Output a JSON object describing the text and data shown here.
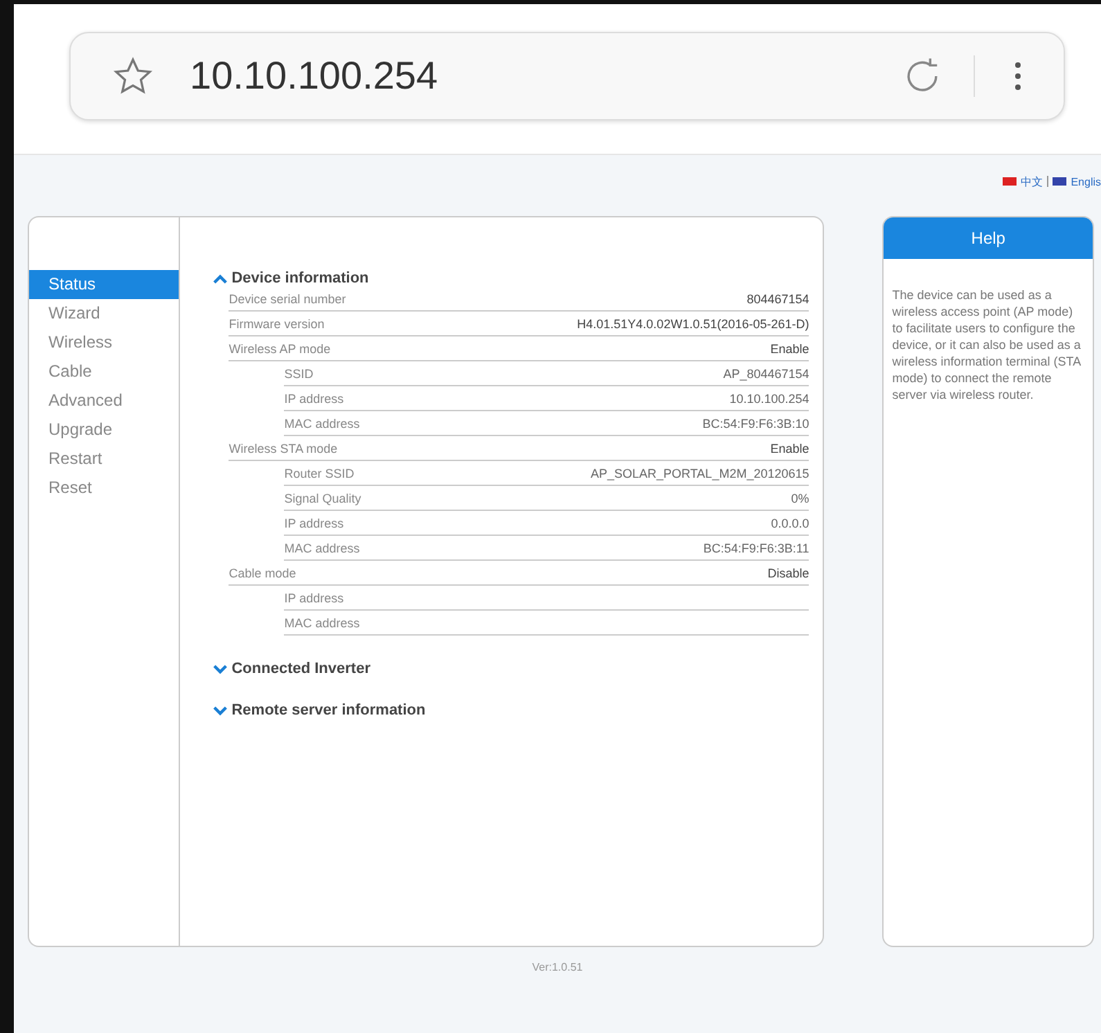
{
  "browser": {
    "url": "10.10.100.254"
  },
  "language": {
    "items": [
      {
        "label": "中文",
        "color": "#dd2222"
      },
      {
        "label": "Englis",
        "color": "#3344aa"
      }
    ]
  },
  "sidebar": {
    "items": [
      {
        "label": "Status",
        "selected": true
      },
      {
        "label": "Wizard",
        "selected": false
      },
      {
        "label": "Wireless",
        "selected": false
      },
      {
        "label": "Cable",
        "selected": false
      },
      {
        "label": "Advanced",
        "selected": false
      },
      {
        "label": "Upgrade",
        "selected": false
      },
      {
        "label": "Restart",
        "selected": false
      },
      {
        "label": "Reset",
        "selected": false
      }
    ]
  },
  "sections": [
    {
      "title": "Device information",
      "expanded": true,
      "rows": [
        {
          "kind": "main",
          "label": "Device serial number",
          "value": "804467154"
        },
        {
          "kind": "main",
          "label": "Firmware version",
          "value": "H4.01.51Y4.0.02W1.0.51(2016-05-261-D)"
        },
        {
          "kind": "main",
          "label": "Wireless AP mode",
          "value": "Enable"
        },
        {
          "kind": "sub",
          "label": "SSID",
          "value": "AP_804467154"
        },
        {
          "kind": "sub",
          "label": "IP address",
          "value": "10.10.100.254"
        },
        {
          "kind": "sub",
          "label": "MAC address",
          "value": "BC:54:F9:F6:3B:10"
        },
        {
          "kind": "main",
          "label": "Wireless STA mode",
          "value": "Enable"
        },
        {
          "kind": "sub",
          "label": "Router SSID",
          "value": "AP_SOLAR_PORTAL_M2M_20120615"
        },
        {
          "kind": "sub",
          "label": "Signal Quality",
          "value": "0%"
        },
        {
          "kind": "sub",
          "label": "IP address",
          "value": "0.0.0.0"
        },
        {
          "kind": "sub",
          "label": "MAC address",
          "value": "BC:54:F9:F6:3B:11"
        },
        {
          "kind": "main",
          "label": "Cable mode",
          "value": "Disable"
        },
        {
          "kind": "sub",
          "label": "IP address"
        },
        {
          "kind": "sub",
          "label": "MAC address"
        }
      ]
    },
    {
      "title": "Connected Inverter",
      "expanded": false
    },
    {
      "title": "Remote server information",
      "expanded": false
    }
  ],
  "help": {
    "title": "Help",
    "text": "The device can be used as a wireless access point (AP mode) to facilitate users to configure the device, or it can also be used as a wireless information terminal (STA mode) to connect the remote server via wireless router."
  },
  "footer": {
    "version": "Ver:1.0.51"
  }
}
